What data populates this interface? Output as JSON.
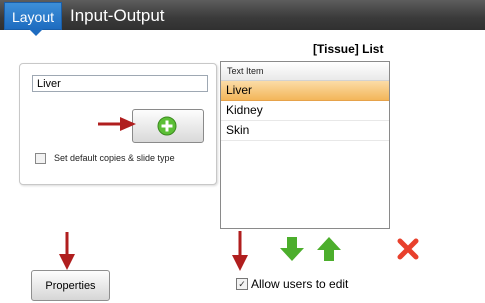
{
  "tabs": {
    "layout": "Layout",
    "input_output": "Input-Output"
  },
  "settings_panel": {
    "text_value": "Liver",
    "checkbox_label": "Set default copies & slide type"
  },
  "list": {
    "title": "[Tissue] List",
    "column_header": "Text Item",
    "items": [
      "Liver",
      "Kidney",
      "Skin"
    ],
    "selected_index": 0
  },
  "properties_button": "Properties",
  "allow_edit": {
    "label": "Allow users to edit",
    "checked": true
  },
  "colors": {
    "tab_active": "#1e6cc0",
    "selection": "#f3b65a",
    "arrow_red": "#b01e1e",
    "move_green": "#4cae2c",
    "delete_red": "#e8402c"
  }
}
